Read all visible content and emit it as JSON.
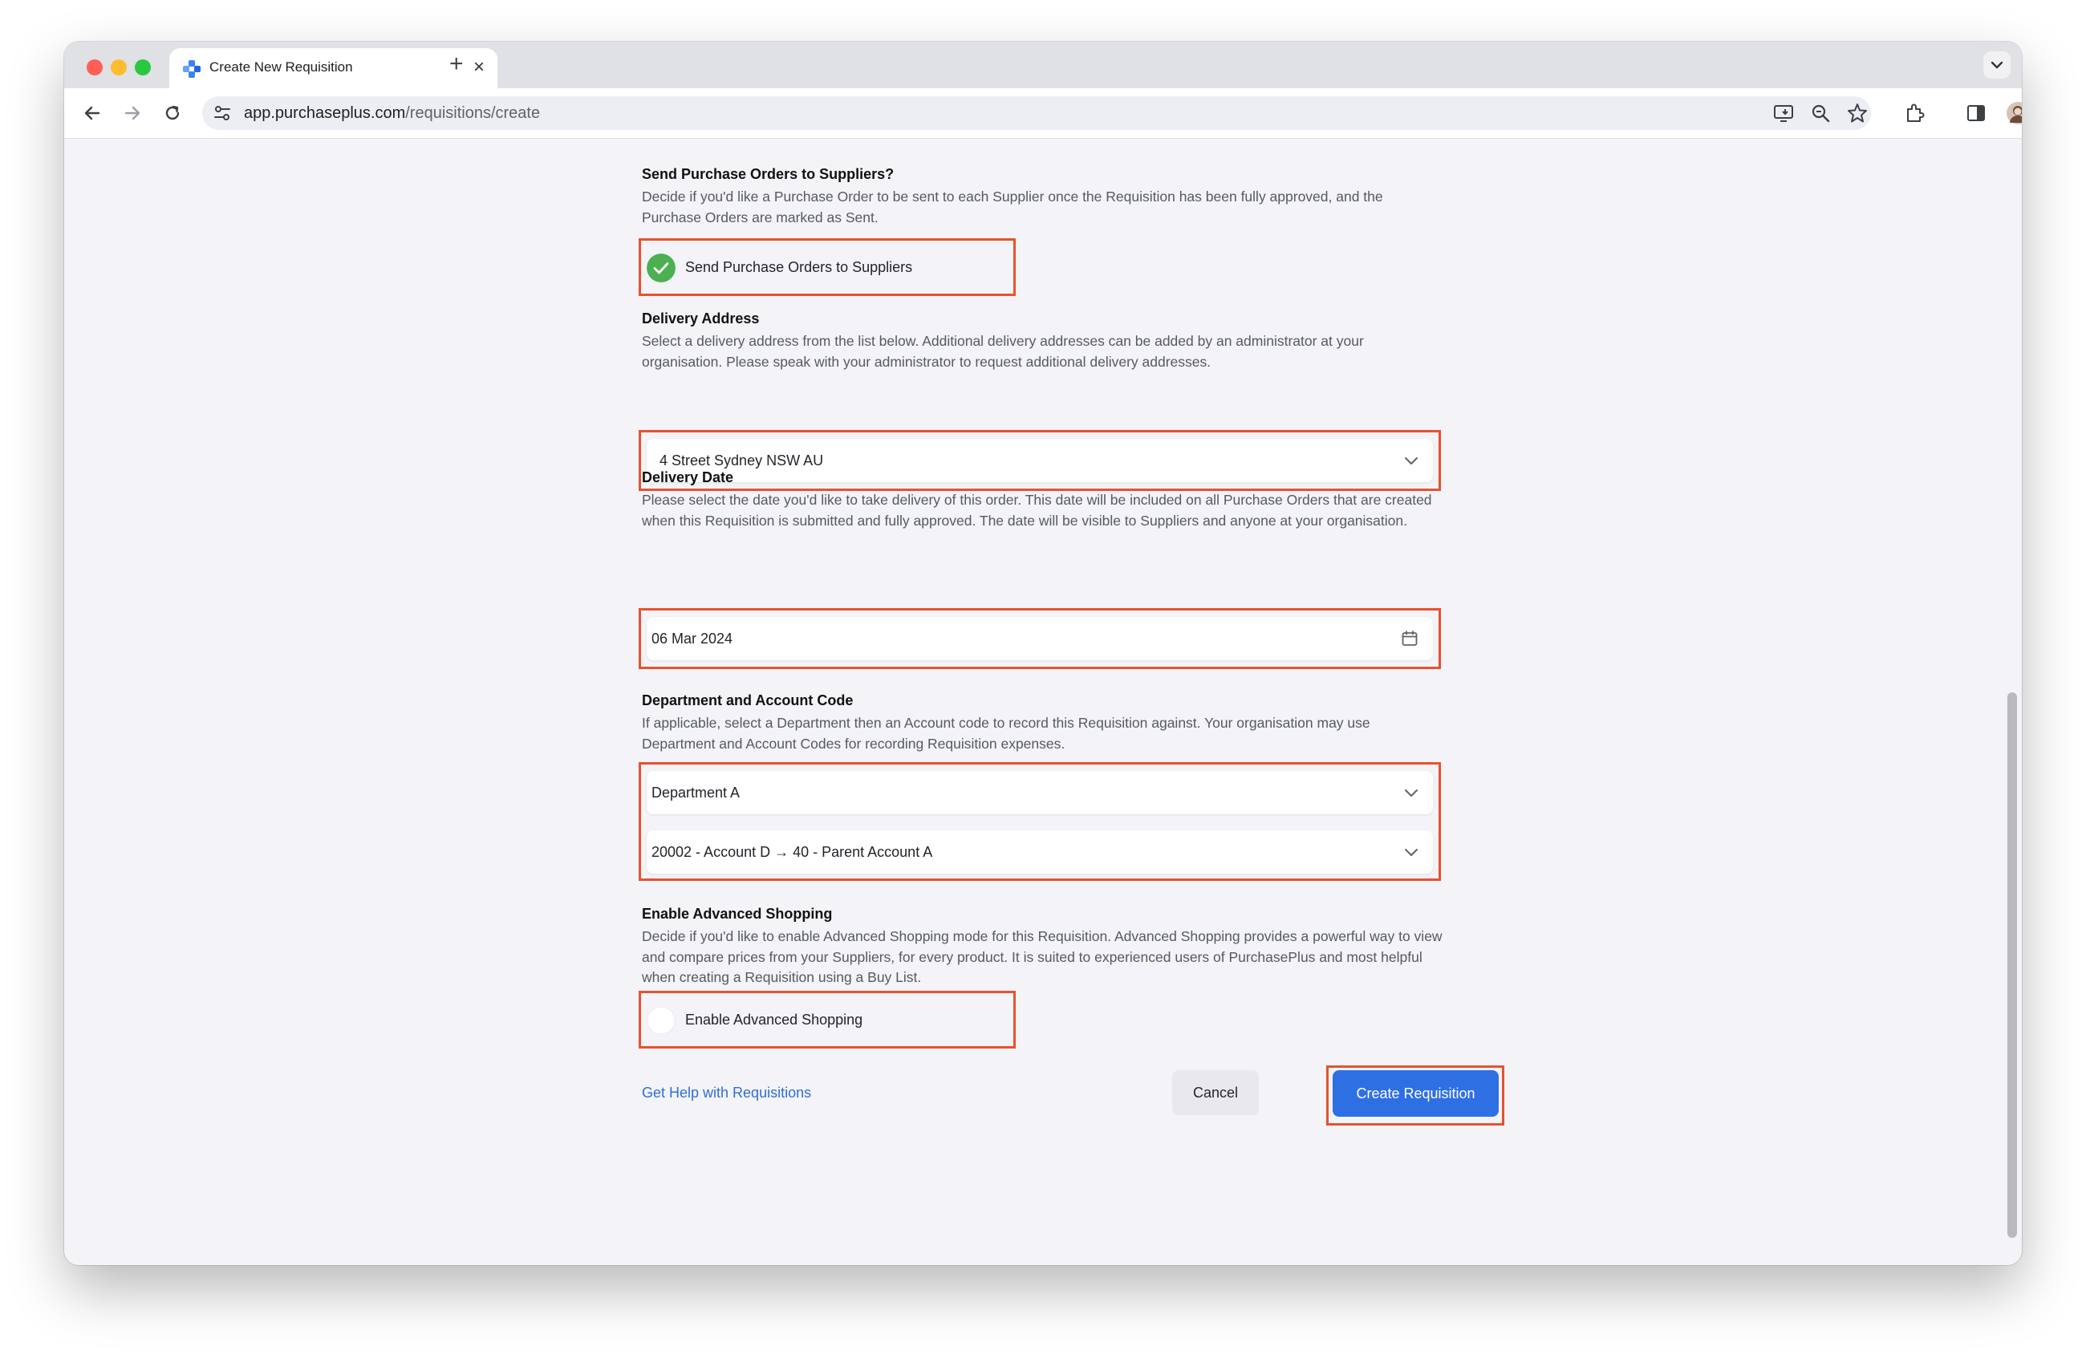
{
  "browser": {
    "tab_title": "Create New Requisition",
    "url_host": "app.purchaseplus.com",
    "url_path": "/requisitions/create"
  },
  "send_po": {
    "title": "Send Purchase Orders to Suppliers?",
    "description": "Decide if you'd like a Purchase Order to be sent to each Supplier once the Requisition has been fully approved, and the Purchase Orders are marked as Sent.",
    "toggle_label": "Send Purchase Orders to Suppliers",
    "checked": true
  },
  "delivery_address": {
    "title": "Delivery Address",
    "description": "Select a delivery address from the list below. Additional delivery addresses can be added by an administrator at your organisation. Please speak with your administrator to request additional delivery addresses.",
    "selected": "4 Street  Sydney NSW AU"
  },
  "delivery_date": {
    "title": "Delivery Date",
    "description": "Please select the date you'd like to take delivery of this order. This date will be included on all Purchase Orders that are created when this Requisition is submitted and fully approved. The date will be visible to Suppliers and anyone at your organisation.",
    "value": "06 Mar 2024"
  },
  "department_account": {
    "title": "Department and Account Code",
    "description": "If applicable, select a Department then an Account code to record this Requisition against. Your organisation may use Department and Account Codes for recording Requisition expenses.",
    "department": "Department A",
    "account": "20002 - Account D → 40 - Parent Account A"
  },
  "advanced_shopping": {
    "title": "Enable Advanced Shopping",
    "description": "Decide if you'd like to enable Advanced Shopping mode for this Requisition. Advanced Shopping provides a powerful way to view and compare prices from your Suppliers, for every product. It is suited to experienced users of PurchasePlus and most helpful when creating a Requisition using a Buy List.",
    "toggle_label": "Enable Advanced Shopping",
    "checked": false
  },
  "actions": {
    "help_link": "Get Help with Requisitions",
    "cancel": "Cancel",
    "create": "Create Requisition"
  },
  "colors": {
    "accent_blue": "#2f6fe4",
    "highlight": "#e8522e",
    "check_green": "#4caf50"
  }
}
